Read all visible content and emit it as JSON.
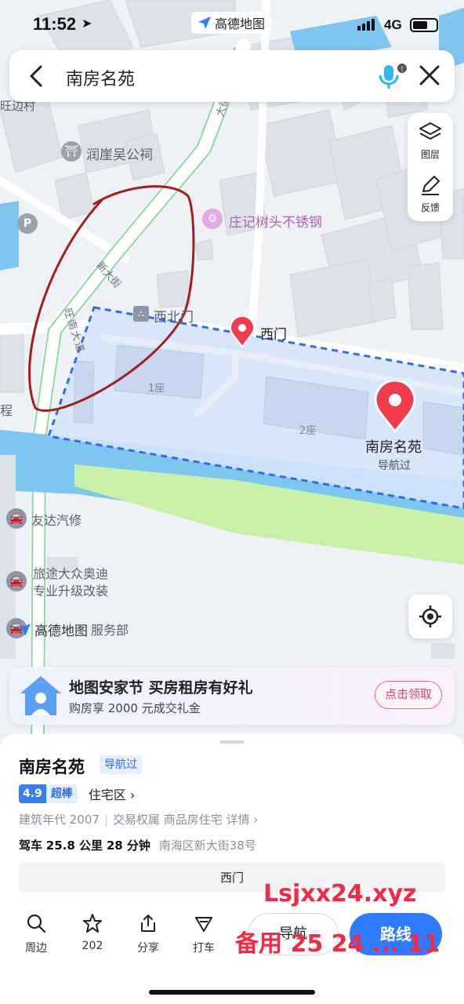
{
  "status_bar": {
    "time": "11:52",
    "network": "4G",
    "center_app": "高德地图"
  },
  "search": {
    "query": "南房名苑"
  },
  "tools": [
    {
      "label": "图层",
      "icon": "layers-icon"
    },
    {
      "label": "反馈",
      "icon": "feedback-pen-icon"
    }
  ],
  "map": {
    "labels": {
      "village_fragment": "旺边村",
      "temple": "润崖吴公祠",
      "shop": "庄记树头不锈钢",
      "street_new": "新大街",
      "avenue": "旺南大道",
      "road_top": "大街",
      "west_north_gate": "西北门",
      "west_gate": "西门",
      "building1": "1座",
      "building2": "2座",
      "place_name": "南房名苑",
      "place_status": "导航过",
      "left_fragment": "程",
      "poi1": "友达汽修",
      "poi2_line1": "旅途大众奥迪",
      "poi2_line2": "专业升级改装",
      "poi3_fragment": "服务部"
    },
    "watermark": "高德地图",
    "colors": {
      "highlight_fill": "#d6e4fb",
      "boundary": "#2f6ee8",
      "water": "#7cc6f0",
      "green": "#c9f0a6",
      "pin": "#ef3d4d",
      "annotation": "#a0201c"
    }
  },
  "promo": {
    "title": "地图安家节 买房租房有好礼",
    "subtitle": "购房享 2000 元成交礼金",
    "button": "点击领取"
  },
  "place": {
    "name": "南房名苑",
    "nav_tag": "导航过",
    "score": "4.9",
    "score_label": "超棒",
    "category": "住宅区",
    "year": "建筑年代 2007",
    "ownership": "交易权属 商品房住宅",
    "detail": "详情",
    "drive_prefix": "驾车",
    "distance": "25.8 公里",
    "duration": "28 分钟",
    "address": "南海区新大街38号",
    "gate": "西门"
  },
  "bottom_bar": {
    "nearby": "周边",
    "favorite_count": "202",
    "share": "分享",
    "taxi": "打车",
    "navigate": "导航",
    "route": "路线"
  },
  "overlay": {
    "line1": "Lsjxx24.xyz",
    "line2": "备用 25 24 ... 11"
  }
}
